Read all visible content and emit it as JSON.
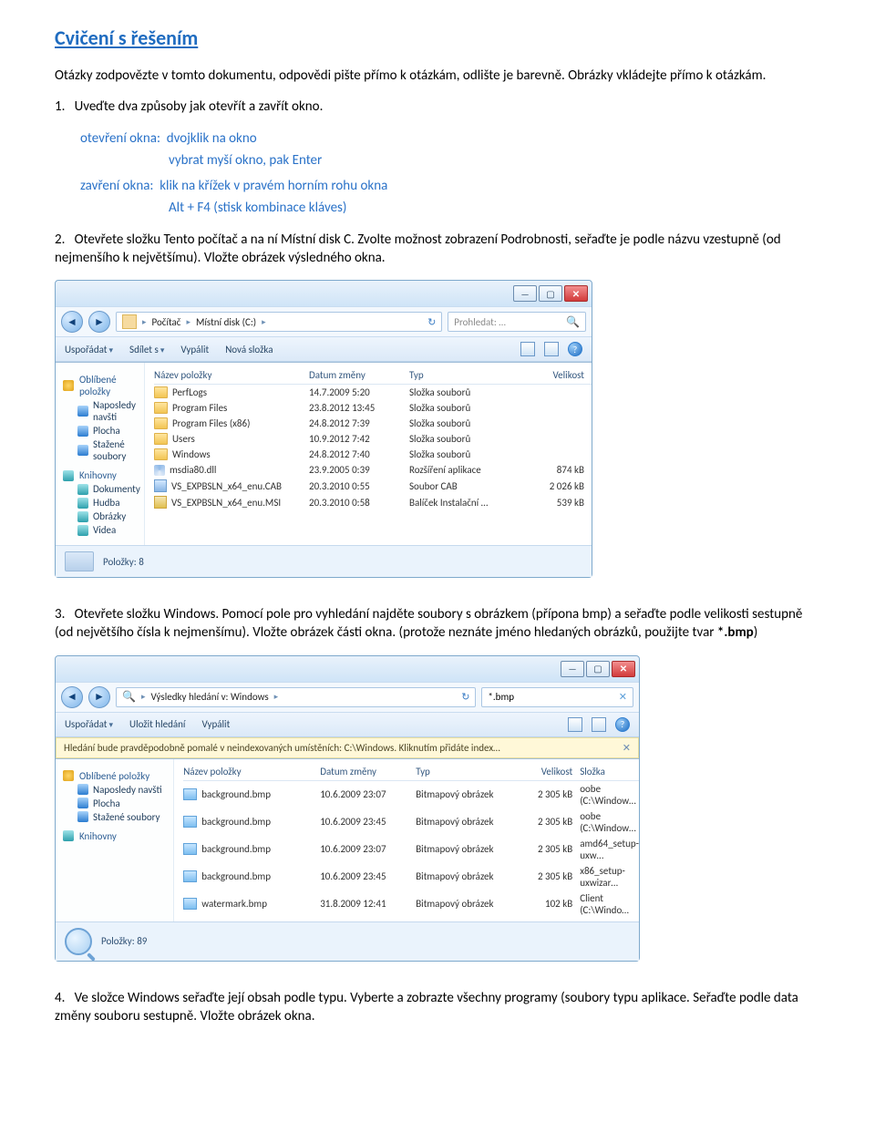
{
  "title": "Cvičení s řešením",
  "intro": "Otázky zodpovězte v tomto dokumentu, odpovědi pište přímo k otázkám, odlište je barevně. Obrázky vkládejte přímo k otázkám.",
  "q1": {
    "num": "1.",
    "text": "Uveďte dva způsoby jak otevřít a zavřít okno.",
    "open_label": "otevření okna:",
    "open_a": "dvojklik na okno",
    "open_b": "vybrat myší okno, pak Enter",
    "close_label": "zavření okna:",
    "close_a": "klik na křížek v pravém horním rohu okna",
    "close_b": "Alt + F4 (stisk kombinace kláves)"
  },
  "q2": {
    "num": "2.",
    "text": "Otevřete složku Tento počítač a na ní Místní disk C. Zvolte možnost zobrazení Podrobnosti, seřaďte je podle názvu vzestupně (od nejmenšího k největšímu). Vložte obrázek výsledného okna."
  },
  "q3": {
    "num": "3.",
    "text_a": "Otevřete složku Windows. Pomocí pole pro vyhledání najděte soubory s obrázkem (přípona bmp) a seřaďte podle velikosti sestupně (od největšího čísla k nejmenšímu). Vložte obrázek části okna. (protože neznáte jméno hledaných obrázků, použijte tvar ",
    "bold": "*.bmp",
    "text_b": ")"
  },
  "q4": {
    "num": "4.",
    "text": "Ve složce Windows seřaďte její obsah podle typu. Vyberte a zobrazte všechny programy (soubory typu aplikace. Seřaďte podle data změny souboru sestupně. Vložte obrázek okna."
  },
  "explorer1": {
    "crumbs": [
      "Počítač",
      "Místní disk (C:)"
    ],
    "search_ph": "Prohledat: …",
    "toolbar": [
      "Uspořádat",
      "Sdílet s",
      "Vypálit",
      "Nová složka"
    ],
    "cols": [
      "Název položky",
      "Datum změny",
      "Typ",
      "Velikost"
    ],
    "side_fav": "Oblíbené položky",
    "side_fav_items": [
      "Naposledy navšti",
      "Plocha",
      "Stažené soubory"
    ],
    "side_lib": "Knihovny",
    "side_lib_items": [
      "Dokumenty",
      "Hudba",
      "Obrázky",
      "Videa"
    ],
    "rows": [
      {
        "icon": "folder",
        "name": "PerfLogs",
        "date": "14.7.2009 5:20",
        "type": "Složka souborů",
        "size": ""
      },
      {
        "icon": "folder",
        "name": "Program Files",
        "date": "23.8.2012 13:45",
        "type": "Složka souborů",
        "size": ""
      },
      {
        "icon": "folder",
        "name": "Program Files (x86)",
        "date": "24.8.2012 7:39",
        "type": "Složka souborů",
        "size": ""
      },
      {
        "icon": "folder",
        "name": "Users",
        "date": "10.9.2012 7:42",
        "type": "Složka souborů",
        "size": ""
      },
      {
        "icon": "folder",
        "name": "Windows",
        "date": "24.8.2012 7:40",
        "type": "Složka souborů",
        "size": ""
      },
      {
        "icon": "dll",
        "name": "msdia80.dll",
        "date": "23.9.2005 0:39",
        "type": "Rozšíření aplikace",
        "size": "874 kB"
      },
      {
        "icon": "cab",
        "name": "VS_EXPBSLN_x64_enu.CAB",
        "date": "20.3.2010 0:55",
        "type": "Soubor CAB",
        "size": "2 026 kB"
      },
      {
        "icon": "msi",
        "name": "VS_EXPBSLN_x64_enu.MSI",
        "date": "20.3.2010 0:58",
        "type": "Balíček Instalační …",
        "size": "539 kB"
      }
    ],
    "status": "Položky: 8"
  },
  "explorer2": {
    "crumbs_label": "Výsledky hledání v: Windows",
    "search_value": "*.bmp",
    "toolbar": [
      "Uspořádat",
      "Uložit hledání",
      "Vypálit"
    ],
    "info": "Hledání bude pravděpodobně pomalé v neindexovaných umístěních: C:\\Windows. Kliknutím přidáte index…",
    "cols": [
      "Název položky",
      "Datum změny",
      "Typ",
      "Velikost",
      "Složka"
    ],
    "side_fav": "Oblíbené položky",
    "side_fav_items": [
      "Naposledy navšti",
      "Plocha",
      "Stažené soubory"
    ],
    "side_lib": "Knihovny",
    "rows": [
      {
        "name": "background.bmp",
        "date": "10.6.2009 23:07",
        "type": "Bitmapový obrázek",
        "size": "2 305 kB",
        "folder": "oobe (C:\\Window…"
      },
      {
        "name": "background.bmp",
        "date": "10.6.2009 23:45",
        "type": "Bitmapový obrázek",
        "size": "2 305 kB",
        "folder": "oobe (C:\\Window…"
      },
      {
        "name": "background.bmp",
        "date": "10.6.2009 23:07",
        "type": "Bitmapový obrázek",
        "size": "2 305 kB",
        "folder": "amd64_setup-uxw…"
      },
      {
        "name": "background.bmp",
        "date": "10.6.2009 23:45",
        "type": "Bitmapový obrázek",
        "size": "2 305 kB",
        "folder": "x86_setup-uxwizar…"
      },
      {
        "name": "watermark.bmp",
        "date": "31.8.2009 12:41",
        "type": "Bitmapový obrázek",
        "size": "102 kB",
        "folder": "Client (C:\\Windo…"
      }
    ],
    "status": "Položky: 89"
  }
}
